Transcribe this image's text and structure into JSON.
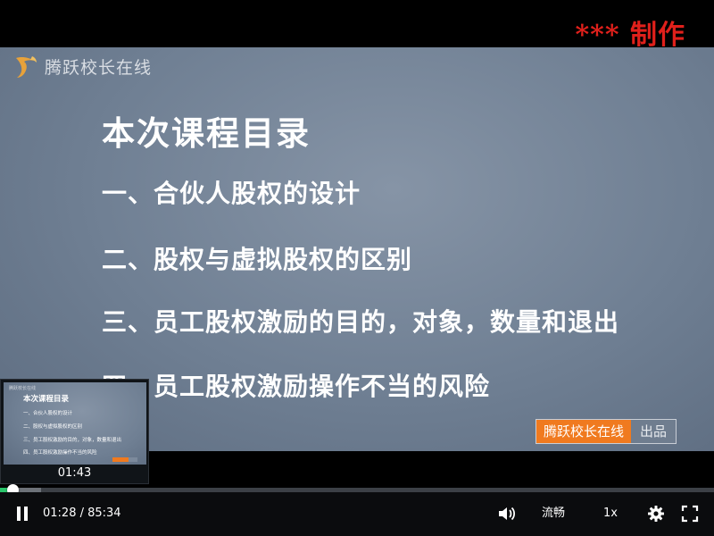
{
  "watermark": "***  制作",
  "slide": {
    "brand": "腾跃校长在线",
    "title": "本次课程目录",
    "items": [
      "一、合伙人股权的设计",
      "二、股权与虚拟股权的区别",
      "三、员工股权激励的目的，对象，数量和退出",
      "四、员工股权激励操作不当的风险"
    ],
    "producer_badge": {
      "name": "腾跃校长在线",
      "suffix": "出品"
    }
  },
  "thumbnail": {
    "brand": "腾跃校长在线",
    "title": "本次课程目录",
    "items": [
      "一、合伙人股权的设计",
      "二、股权与虚拟股权的区别",
      "三、员工股权激励的目的，对象，数量和退出",
      "四、员工股权激励操作不当的风险"
    ],
    "time": "01:43"
  },
  "player": {
    "current_time": "01:28",
    "duration": "85:34",
    "time_display": "01:28 / 85:34",
    "played_fraction": 0.017,
    "buffered_fraction": 0.058,
    "quality_label": "流畅",
    "speed_label": "1x",
    "icons": {
      "play_state": "pause-icon",
      "volume": "volume-icon",
      "settings": "gear-icon",
      "fullscreen": "fullscreen-icon"
    },
    "colors": {
      "played": "#29c46a",
      "accent_badge": "#f07a1f",
      "watermark": "#e0201b"
    }
  }
}
